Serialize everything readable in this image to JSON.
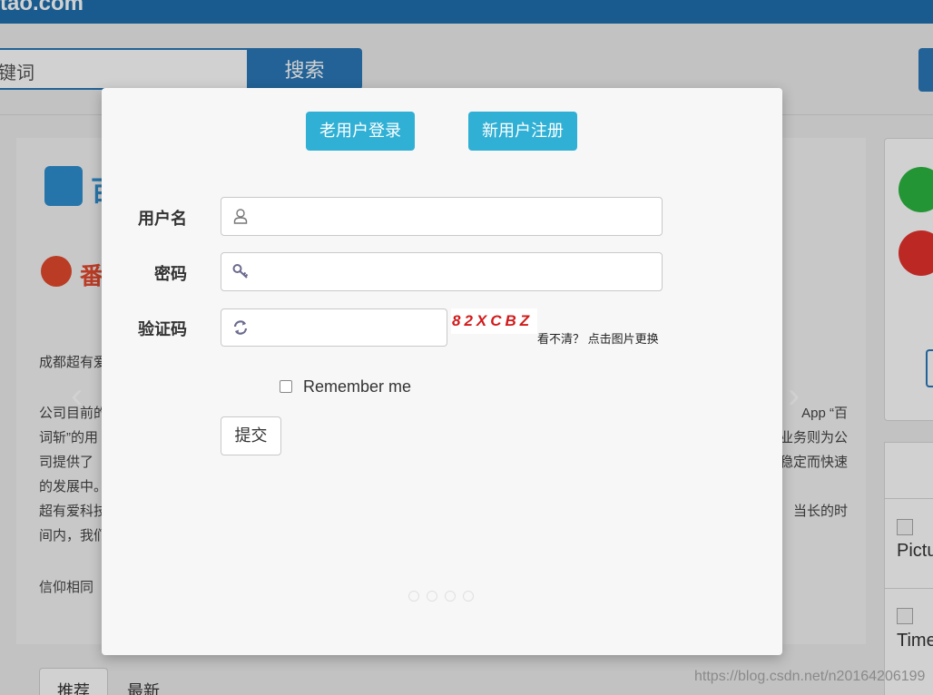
{
  "header": {
    "brand": "tao.com",
    "search_placeholder": "键词",
    "search_button": "搜索"
  },
  "carousel": {
    "logo_text": "百",
    "tomato_text": "番",
    "lines_left": [
      "成都超有爱",
      "公司目前的",
      "词斩”的用",
      "司提供了",
      "的发展中。",
      "超有爱科技",
      "间内，我们",
      "信仰相同"
    ],
    "lines_right": [
      "App “百",
      "业务则为公",
      "稳定而快速",
      "当长的时"
    ]
  },
  "side": {
    "items": [
      "Pictu",
      "Time"
    ]
  },
  "tabs": [
    "推荐",
    "最新"
  ],
  "watermark": "https://blog.csdn.net/n20164206199",
  "modal": {
    "login_tab": "老用户登录",
    "register_tab": "新用户注册",
    "username_label": "用户名",
    "password_label": "密码",
    "captcha_label": "验证码",
    "captcha_text": "82XCBZ",
    "captcha_tip": "看不清？ 点击图片更换",
    "remember": "Remember me",
    "submit": "提交"
  },
  "colors": {
    "primary": "#30b0d5",
    "brand": "#1f6fae",
    "captcha": "#d21a1a"
  }
}
